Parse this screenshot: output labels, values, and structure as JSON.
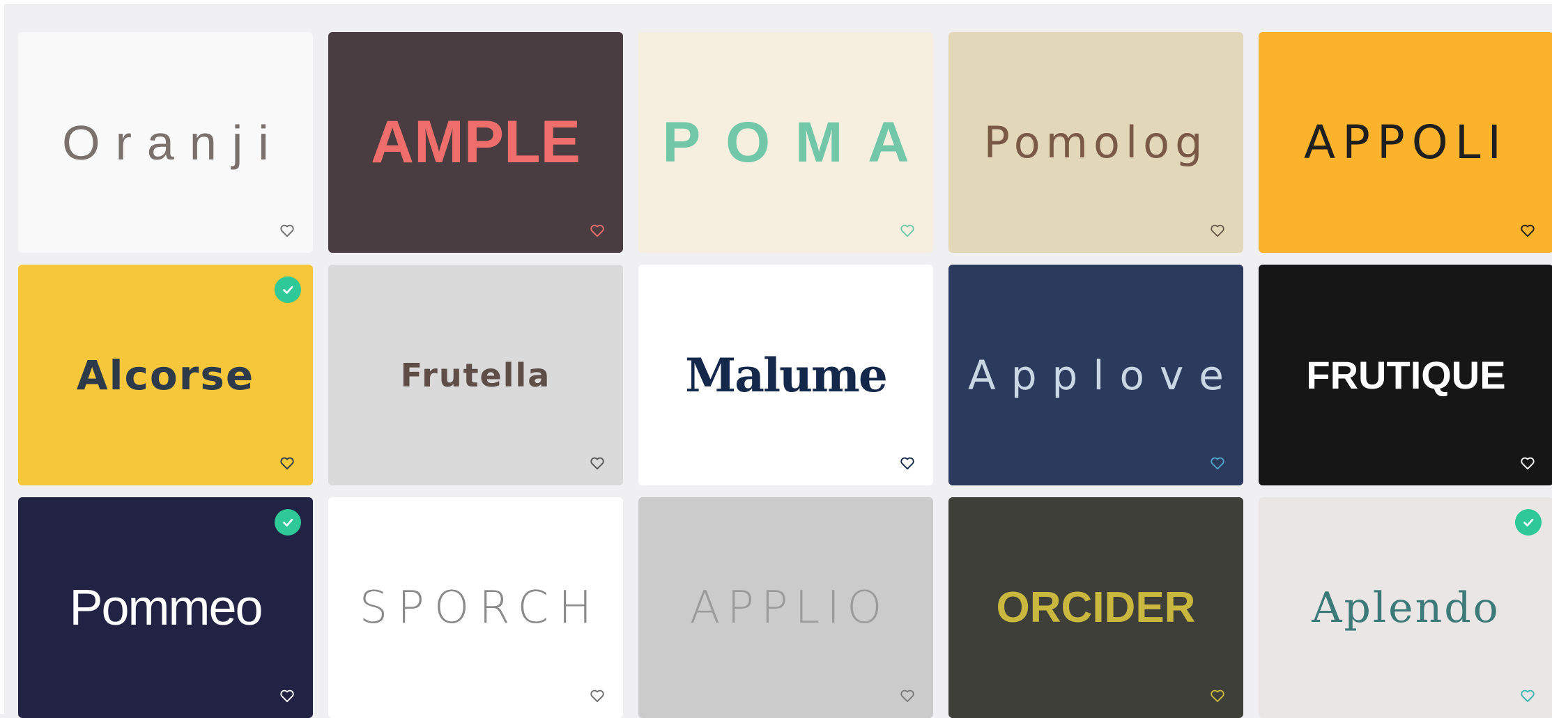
{
  "cards": [
    {
      "name": "Oranji",
      "bg": "#f9f9f9",
      "fg": "#7a716c",
      "heart": "#6b6b6b",
      "selected": false
    },
    {
      "name": "AMPLE",
      "bg": "#4a3d41",
      "fg": "#ef6e6c",
      "heart": "#ef6e6c",
      "selected": false
    },
    {
      "name": "POMA",
      "bg": "#f6efe0",
      "fg": "#72c7a9",
      "heart": "#72c7a9",
      "selected": false
    },
    {
      "name": "Pomolog",
      "bg": "#e2d8b9",
      "fg": "#7a5a47",
      "heart": "#6b5a4c",
      "selected": false
    },
    {
      "name": "APPOLI",
      "bg": "#fdb22b",
      "fg": "#1f1f1f",
      "heart": "#1f1f1f",
      "selected": false
    },
    {
      "name": "Alcorse",
      "bg": "#f6c63b",
      "fg": "#2d3a4a",
      "heart": "#2d3a4a",
      "selected": true
    },
    {
      "name": "Frutella",
      "bg": "#dadada",
      "fg": "#5f4e48",
      "heart": "#555555",
      "selected": false
    },
    {
      "name": "Malume",
      "bg": "#ffffff",
      "fg": "#14284b",
      "heart": "#14284b",
      "selected": false
    },
    {
      "name": "Applove",
      "bg": "#2b3a5d",
      "fg": "#c9d6e3",
      "heart": "#4fa3c8",
      "selected": false
    },
    {
      "name": "FRUTIQUE",
      "bg": "#161616",
      "fg": "#ffffff",
      "heart": "#ffffff",
      "selected": false
    },
    {
      "name": "Pommeo",
      "bg": "#222344",
      "fg": "#ffffff",
      "heart": "#ffffff",
      "selected": true
    },
    {
      "name": "SPORCH",
      "bg": "#ffffff",
      "fg": "#8a8a8a",
      "heart": "#6b6b6b",
      "selected": false
    },
    {
      "name": "APPLIO",
      "bg": "#cbcbcb",
      "fg": "#9b9b9b",
      "heart": "#7a7a7a",
      "selected": false
    },
    {
      "name": "ORCIDER",
      "bg": "#3f3f3a",
      "fg": "#c9b83d",
      "heart": "#c9b83d",
      "selected": false
    },
    {
      "name": "Aplendo",
      "bg": "#ebe6e6",
      "fg": "#3b7a78",
      "heart": "#3bb4b1",
      "selected": true
    }
  ],
  "check_color": "#2fc897",
  "icons": {
    "favorite": "heart-icon",
    "selected": "check-icon"
  }
}
